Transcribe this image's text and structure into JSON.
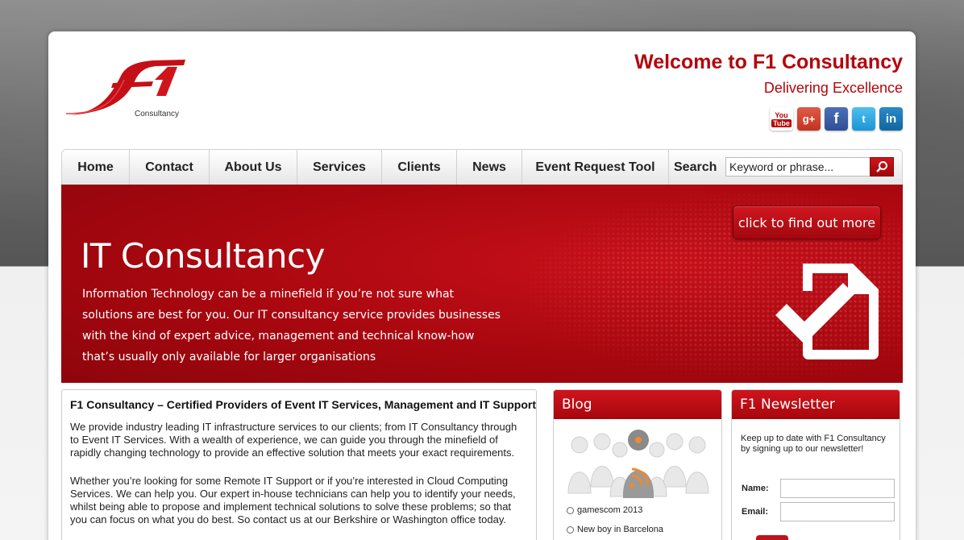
{
  "header": {
    "logo_sub": "Consultancy",
    "welcome": "Welcome to F1 Consultancy",
    "tagline": "Delivering Excellence",
    "social": {
      "youtube_top": "You",
      "youtube_bottom": "Tube",
      "googleplus": "g+",
      "facebook": "f",
      "twitter": "t",
      "linkedin": "in"
    }
  },
  "nav": {
    "items": [
      "Home",
      "Contact",
      "About Us",
      "Services",
      "Clients",
      "News",
      "Event Request Tool"
    ],
    "search_label": "Search",
    "search_placeholder": "Keyword or phrase..."
  },
  "banner": {
    "title": "IT Consultancy",
    "text": "Information Technology can be a minefield if you’re not sure what solutions are best for you. Our IT consultancy service provides businesses with the kind of expert advice, management and technical know-how that’s usually only available for larger organisations",
    "cta": "click to find out more"
  },
  "main": {
    "heading": "F1 Consultancy – Certified Providers of Event IT Services, Management and IT Support",
    "p1": "We provide industry leading IT infrastructure services to our clients; from IT Consultancy through to Event IT Services. With a wealth of experience, we can guide you through the minefield of rapidly changing technology to provide an effective solution that meets your exact requirements.",
    "p2": "Whether you’re looking for some Remote IT Support or if you’re interested in Cloud Computing Services. We can help you. Our expert in-house technicians can help you to identify your needs, whilst being able to propose and implement technical solutions to solve these problems; so that you can focus on what you do best. So contact us at our Berkshire or Washington office today."
  },
  "blog": {
    "title": "Blog",
    "items": [
      "gamescom 2013",
      "New boy in Barcelona"
    ]
  },
  "newsletter": {
    "title": "F1 Newsletter",
    "text": "Keep up to date with F1 Consultancy by signing up to our newsletter!",
    "name_label": "Name:",
    "email_label": "Email:"
  },
  "colors": {
    "brand_red": "#b3060d",
    "banner_red": "#a8070f"
  }
}
